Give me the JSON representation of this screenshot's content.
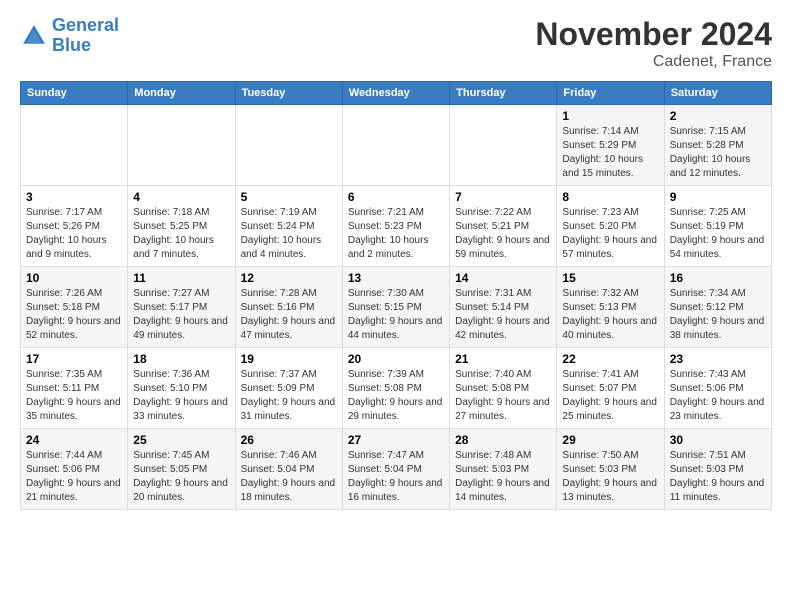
{
  "logo": {
    "line1": "General",
    "line2": "Blue"
  },
  "header": {
    "month": "November 2024",
    "location": "Cadenet, France"
  },
  "days_of_week": [
    "Sunday",
    "Monday",
    "Tuesday",
    "Wednesday",
    "Thursday",
    "Friday",
    "Saturday"
  ],
  "weeks": [
    [
      {
        "day": "",
        "info": ""
      },
      {
        "day": "",
        "info": ""
      },
      {
        "day": "",
        "info": ""
      },
      {
        "day": "",
        "info": ""
      },
      {
        "day": "",
        "info": ""
      },
      {
        "day": "1",
        "info": "Sunrise: 7:14 AM\nSunset: 5:29 PM\nDaylight: 10 hours and 15 minutes."
      },
      {
        "day": "2",
        "info": "Sunrise: 7:15 AM\nSunset: 5:28 PM\nDaylight: 10 hours and 12 minutes."
      }
    ],
    [
      {
        "day": "3",
        "info": "Sunrise: 7:17 AM\nSunset: 5:26 PM\nDaylight: 10 hours and 9 minutes."
      },
      {
        "day": "4",
        "info": "Sunrise: 7:18 AM\nSunset: 5:25 PM\nDaylight: 10 hours and 7 minutes."
      },
      {
        "day": "5",
        "info": "Sunrise: 7:19 AM\nSunset: 5:24 PM\nDaylight: 10 hours and 4 minutes."
      },
      {
        "day": "6",
        "info": "Sunrise: 7:21 AM\nSunset: 5:23 PM\nDaylight: 10 hours and 2 minutes."
      },
      {
        "day": "7",
        "info": "Sunrise: 7:22 AM\nSunset: 5:21 PM\nDaylight: 9 hours and 59 minutes."
      },
      {
        "day": "8",
        "info": "Sunrise: 7:23 AM\nSunset: 5:20 PM\nDaylight: 9 hours and 57 minutes."
      },
      {
        "day": "9",
        "info": "Sunrise: 7:25 AM\nSunset: 5:19 PM\nDaylight: 9 hours and 54 minutes."
      }
    ],
    [
      {
        "day": "10",
        "info": "Sunrise: 7:26 AM\nSunset: 5:18 PM\nDaylight: 9 hours and 52 minutes."
      },
      {
        "day": "11",
        "info": "Sunrise: 7:27 AM\nSunset: 5:17 PM\nDaylight: 9 hours and 49 minutes."
      },
      {
        "day": "12",
        "info": "Sunrise: 7:28 AM\nSunset: 5:16 PM\nDaylight: 9 hours and 47 minutes."
      },
      {
        "day": "13",
        "info": "Sunrise: 7:30 AM\nSunset: 5:15 PM\nDaylight: 9 hours and 44 minutes."
      },
      {
        "day": "14",
        "info": "Sunrise: 7:31 AM\nSunset: 5:14 PM\nDaylight: 9 hours and 42 minutes."
      },
      {
        "day": "15",
        "info": "Sunrise: 7:32 AM\nSunset: 5:13 PM\nDaylight: 9 hours and 40 minutes."
      },
      {
        "day": "16",
        "info": "Sunrise: 7:34 AM\nSunset: 5:12 PM\nDaylight: 9 hours and 38 minutes."
      }
    ],
    [
      {
        "day": "17",
        "info": "Sunrise: 7:35 AM\nSunset: 5:11 PM\nDaylight: 9 hours and 35 minutes."
      },
      {
        "day": "18",
        "info": "Sunrise: 7:36 AM\nSunset: 5:10 PM\nDaylight: 9 hours and 33 minutes."
      },
      {
        "day": "19",
        "info": "Sunrise: 7:37 AM\nSunset: 5:09 PM\nDaylight: 9 hours and 31 minutes."
      },
      {
        "day": "20",
        "info": "Sunrise: 7:39 AM\nSunset: 5:08 PM\nDaylight: 9 hours and 29 minutes."
      },
      {
        "day": "21",
        "info": "Sunrise: 7:40 AM\nSunset: 5:08 PM\nDaylight: 9 hours and 27 minutes."
      },
      {
        "day": "22",
        "info": "Sunrise: 7:41 AM\nSunset: 5:07 PM\nDaylight: 9 hours and 25 minutes."
      },
      {
        "day": "23",
        "info": "Sunrise: 7:43 AM\nSunset: 5:06 PM\nDaylight: 9 hours and 23 minutes."
      }
    ],
    [
      {
        "day": "24",
        "info": "Sunrise: 7:44 AM\nSunset: 5:06 PM\nDaylight: 9 hours and 21 minutes."
      },
      {
        "day": "25",
        "info": "Sunrise: 7:45 AM\nSunset: 5:05 PM\nDaylight: 9 hours and 20 minutes."
      },
      {
        "day": "26",
        "info": "Sunrise: 7:46 AM\nSunset: 5:04 PM\nDaylight: 9 hours and 18 minutes."
      },
      {
        "day": "27",
        "info": "Sunrise: 7:47 AM\nSunset: 5:04 PM\nDaylight: 9 hours and 16 minutes."
      },
      {
        "day": "28",
        "info": "Sunrise: 7:48 AM\nSunset: 5:03 PM\nDaylight: 9 hours and 14 minutes."
      },
      {
        "day": "29",
        "info": "Sunrise: 7:50 AM\nSunset: 5:03 PM\nDaylight: 9 hours and 13 minutes."
      },
      {
        "day": "30",
        "info": "Sunrise: 7:51 AM\nSunset: 5:03 PM\nDaylight: 9 hours and 11 minutes."
      }
    ]
  ]
}
